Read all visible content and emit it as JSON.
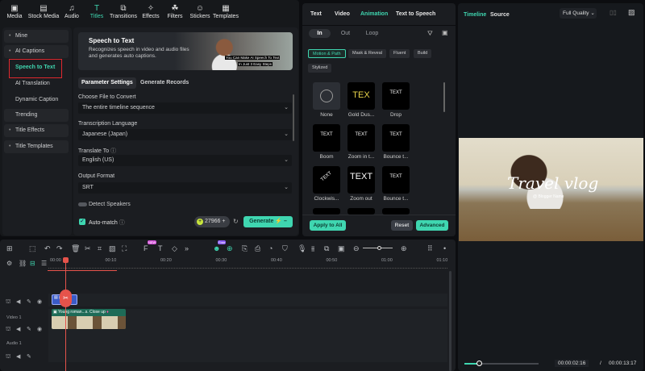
{
  "toolbar": {
    "items": [
      {
        "label": "Media",
        "icon": "media-icon"
      },
      {
        "label": "Stock Media",
        "icon": "stock-media-icon"
      },
      {
        "label": "Audio",
        "icon": "audio-icon"
      },
      {
        "label": "Titles",
        "icon": "titles-icon",
        "active": true
      },
      {
        "label": "Transitions",
        "icon": "transitions-icon"
      },
      {
        "label": "Effects",
        "icon": "effects-icon"
      },
      {
        "label": "Filters",
        "icon": "filters-icon"
      },
      {
        "label": "Stickers",
        "icon": "stickers-icon"
      },
      {
        "label": "Templates",
        "icon": "templates-icon"
      }
    ]
  },
  "sidebar": {
    "items": [
      {
        "label": "Mine"
      },
      {
        "label": "AI Captions"
      },
      {
        "label": "Speech to Text",
        "selected": true
      },
      {
        "label": "AI Translation"
      },
      {
        "label": "Dynamic Caption"
      },
      {
        "label": "Trending"
      },
      {
        "label": "Title Effects"
      },
      {
        "label": "Title Templates"
      }
    ]
  },
  "banner": {
    "title": "Speech to Text",
    "description": "Recognizes speech in video and audio files and generates auto captions.",
    "image_caption_1": "You Can Make AI Speech To Text",
    "image_caption_2": "In Just 3 Easy Steps"
  },
  "tabs": {
    "parameter_settings": "Parameter Settings",
    "generate_records": "Generate Records"
  },
  "form": {
    "file_label": "Choose File to Convert",
    "file_value": "The entire timeline sequence",
    "language_label": "Transcription Language",
    "language_value": "Japanese (Japan)",
    "translate_label": "Translate To",
    "translate_value": "English (US)",
    "format_label": "Output Format",
    "format_value": "SRT",
    "detect_speakers": "Detect Speakers",
    "auto_match": "Auto-match",
    "credits": "27966",
    "generate": "Generate"
  },
  "props": {
    "tabs": [
      "Text",
      "Video",
      "Animation",
      "Text to Speech"
    ],
    "active_tab": "Animation",
    "subtabs": [
      "In",
      "Out",
      "Loop"
    ],
    "chips": [
      "Motion & Path",
      "Mask & Reveal",
      "Fluent",
      "Build",
      "Stylized"
    ],
    "animations": [
      {
        "name": "None",
        "preview": ""
      },
      {
        "name": "Gold Dus...",
        "preview": "TEX"
      },
      {
        "name": "Drop",
        "preview": "TEXT"
      },
      {
        "name": "Boom",
        "preview": "TEXT"
      },
      {
        "name": "Zoom in t...",
        "preview": "TEXT"
      },
      {
        "name": "Bounce t...",
        "preview": "TEXT"
      },
      {
        "name": "Clockwis...",
        "preview": "TEXT"
      },
      {
        "name": "Zoom out",
        "preview": "TEXT"
      },
      {
        "name": "Bounce t...",
        "preview": "TEXT"
      }
    ],
    "apply_all": "Apply to All",
    "reset": "Reset",
    "advanced": "Advanced"
  },
  "preview": {
    "tab_timeline": "Timeline",
    "tab_source": "Source",
    "quality": "Full Quality",
    "title_overlay": "Travel vlog",
    "subtitle_overlay": "@ Blogger Name",
    "current_time": "00:00:02:16",
    "separator": "/",
    "total_time": "00:00:13:17",
    "progress": 0.2
  },
  "timeline": {
    "ticks": [
      "00:00",
      "00:10",
      "00:20",
      "00:30",
      "00:40",
      "00:50",
      "01:00",
      "01:10"
    ],
    "tracks": [
      {
        "label": ""
      },
      {
        "label": "Video 1"
      },
      {
        "label": "Audio 1"
      }
    ],
    "clip_title": "Young roman...s. Close up",
    "badge_new": "NEW",
    "badge_free": "Free"
  },
  "colors": {
    "accent": "#3fd6b0",
    "playhead": "#e5534b",
    "selection": "#e0282e"
  }
}
